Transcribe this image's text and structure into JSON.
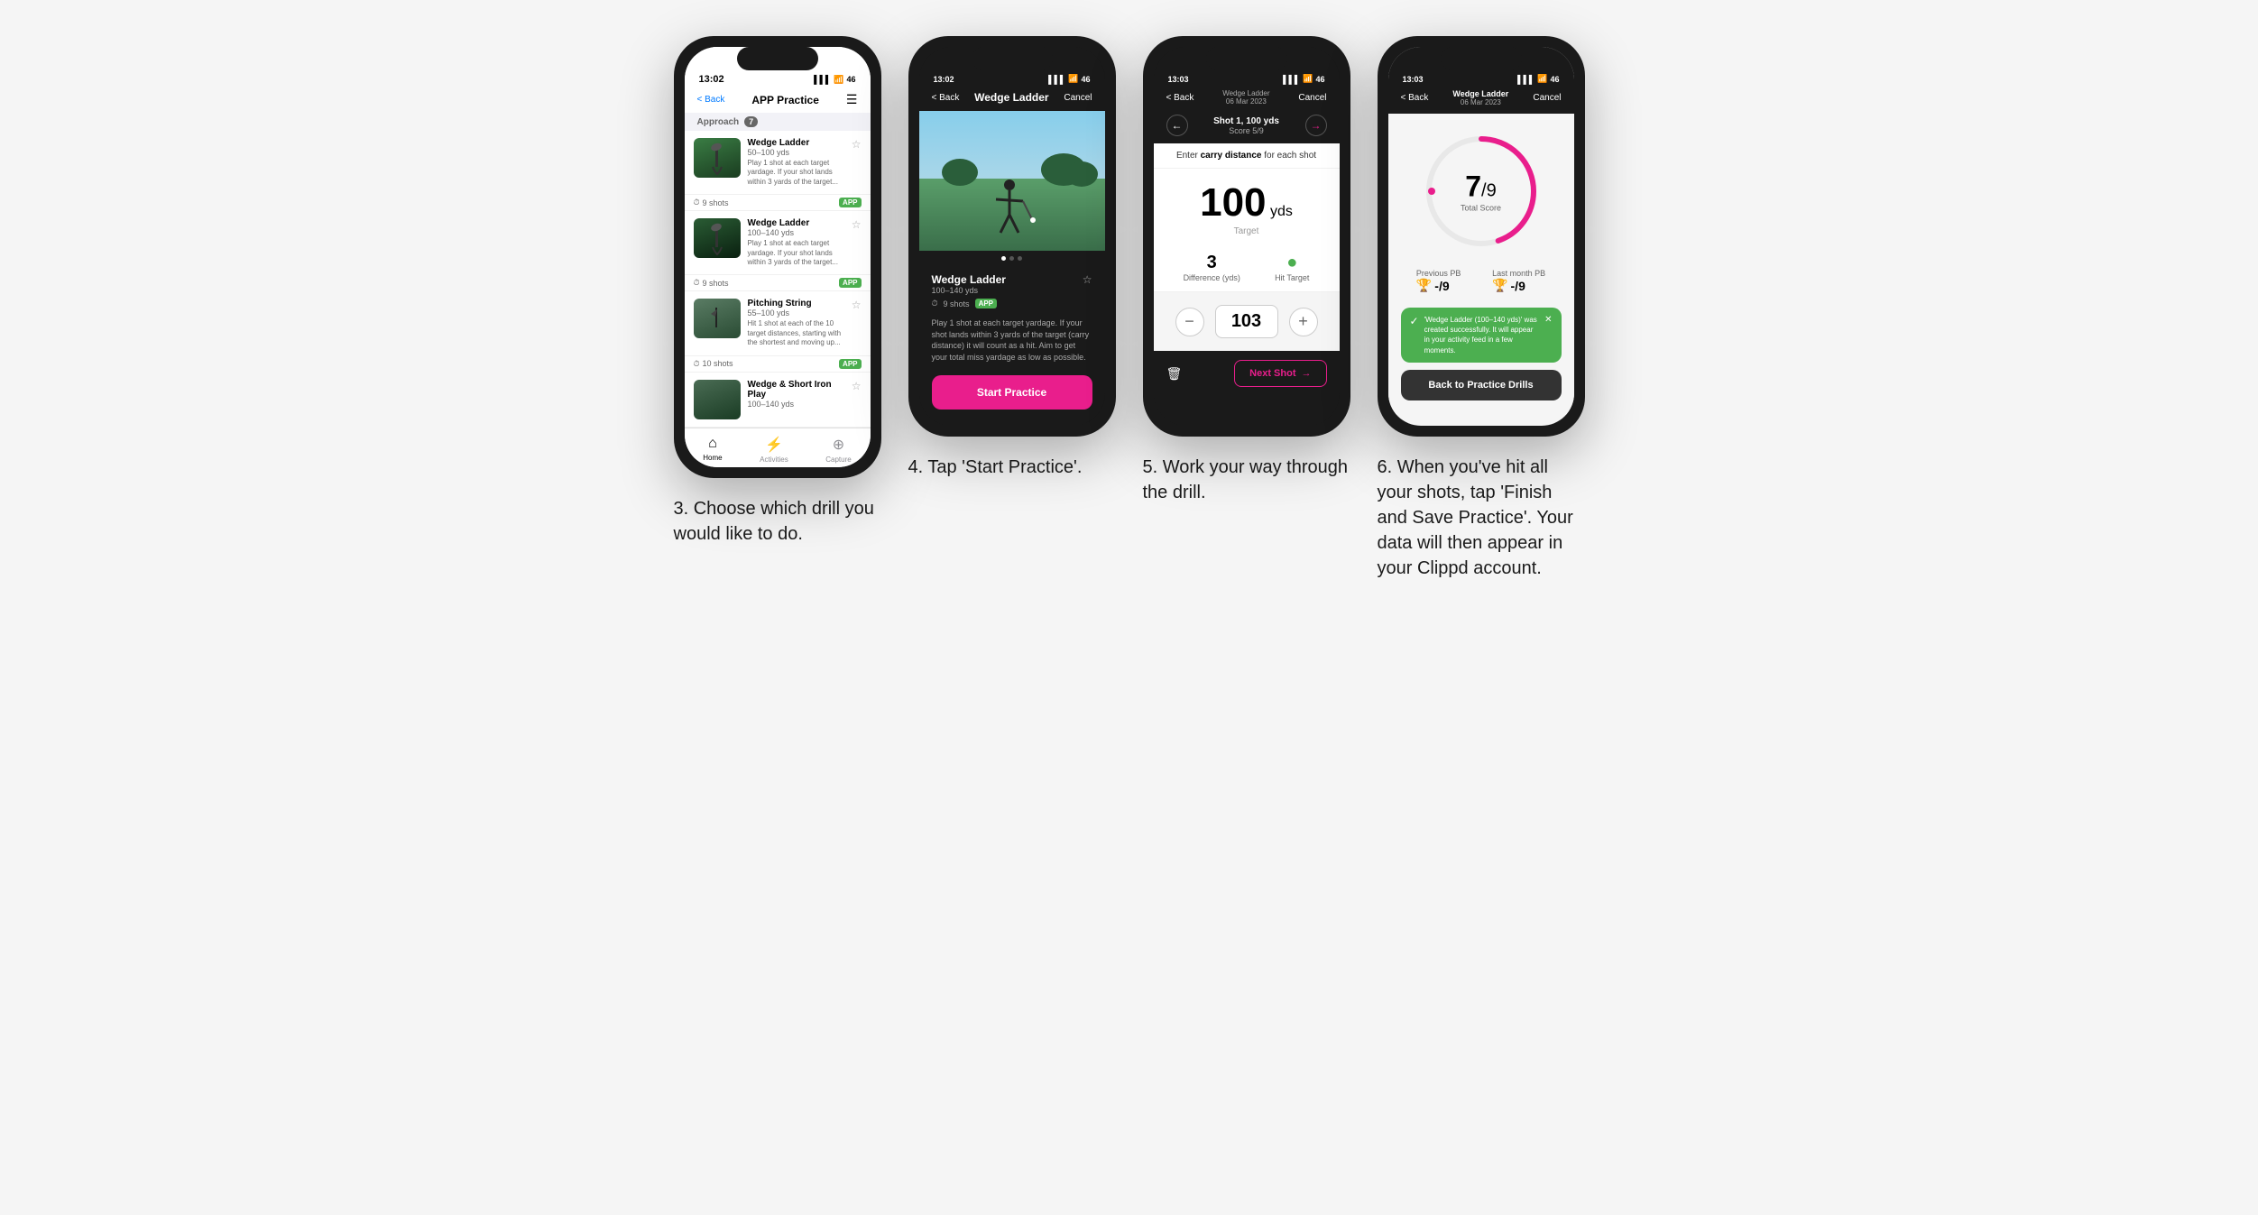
{
  "phones": [
    {
      "id": "phone1",
      "time": "13:02",
      "title": "APP Practice",
      "back": "< Back",
      "menu": "☰",
      "section": "Approach",
      "section_count": "7",
      "drills": [
        {
          "name": "Wedge Ladder",
          "yds": "50–100 yds",
          "desc": "Play 1 shot at each target yardage. If your shot lands within 3 yards of the target...",
          "shots": "9 shots",
          "badge": "APP"
        },
        {
          "name": "Wedge Ladder",
          "yds": "100–140 yds",
          "desc": "Play 1 shot at each target yardage. If your shot lands within 3 yards of the target...",
          "shots": "9 shots",
          "badge": "APP"
        },
        {
          "name": "Pitching String",
          "yds": "55–100 yds",
          "desc": "Hit 1 shot at each of the 10 target distances, starting with the shortest and moving up...",
          "shots": "10 shots",
          "badge": "APP"
        },
        {
          "name": "Wedge & Short Iron Play",
          "yds": "100–140 yds",
          "desc": "",
          "shots": "",
          "badge": ""
        }
      ],
      "bottom_nav": [
        "Home",
        "Activities",
        "Capture"
      ]
    },
    {
      "id": "phone2",
      "time": "13:02",
      "title": "Wedge Ladder",
      "back": "< Back",
      "cancel": "Cancel",
      "drill_name": "Wedge Ladder",
      "drill_yds": "100–140 yds",
      "shots": "9 shots",
      "badge": "APP",
      "description": "Play 1 shot at each target yardage. If your shot lands within 3 yards of the target (carry distance) it will count as a hit. Aim to get your total miss yardage as low as possible.",
      "start_btn": "Start Practice"
    },
    {
      "id": "phone3",
      "time": "13:03",
      "drill_title": "Wedge Ladder",
      "drill_subtitle": "06 Mar 2023",
      "back": "< Back",
      "cancel": "Cancel",
      "shot_label": "Shot 1, 100 yds",
      "score_label": "Score 5/9",
      "carry_instruction": "Enter carry distance for each shot",
      "target_value": "100",
      "target_unit": "yds",
      "target_label": "Target",
      "difference": "3",
      "difference_label": "Difference (yds)",
      "hit_target_label": "Hit Target",
      "input_value": "103",
      "next_shot": "Next Shot"
    },
    {
      "id": "phone4",
      "time": "13:03",
      "drill_title": "Wedge Ladder",
      "drill_subtitle": "06 Mar 2023",
      "back": "< Back",
      "cancel": "Cancel",
      "score": "7",
      "score_denom": "/9",
      "total_score_label": "Total Score",
      "prev_pb_label": "Previous PB",
      "prev_pb_value": "-/9",
      "last_month_pb_label": "Last month PB",
      "last_month_pb_value": "-/9",
      "toast_text": "'Wedge Ladder (100–140 yds)' was created successfully. It will appear in your activity feed in a few moments.",
      "back_btn": "Back to Practice Drills"
    }
  ],
  "captions": [
    "3. Choose which drill you would like to do.",
    "4. Tap 'Start Practice'.",
    "5. Work your way through the drill.",
    "6. When you've hit all your shots, tap 'Finish and Save Practice'. Your data will then appear in your Clippd account."
  ],
  "colors": {
    "accent_pink": "#e91e8c",
    "accent_green": "#4CAF50",
    "dark_bg": "#1a1a1a",
    "light_bg": "#f5f5f5"
  }
}
